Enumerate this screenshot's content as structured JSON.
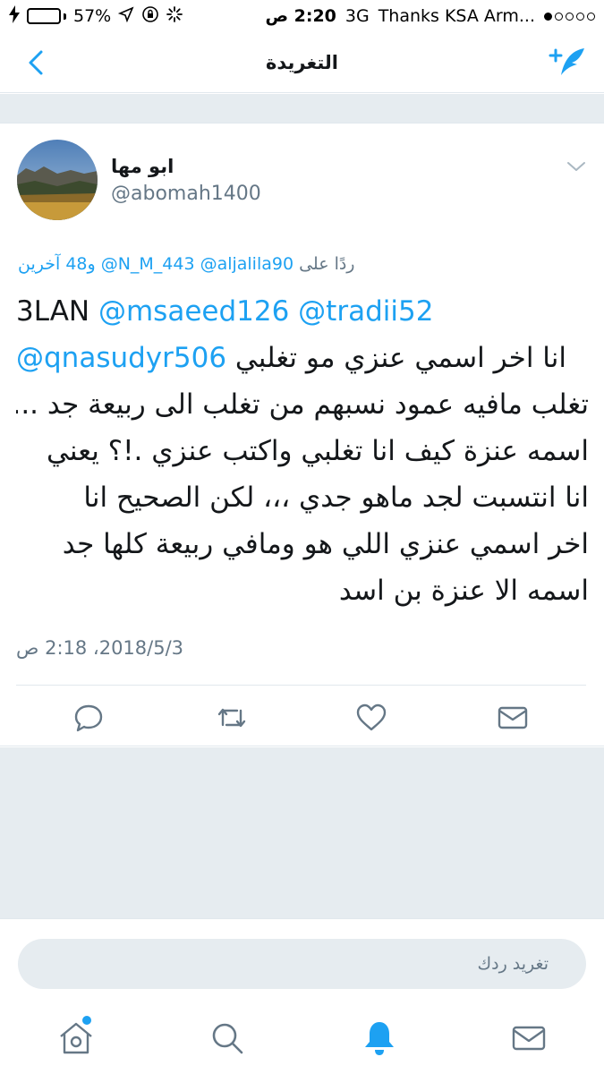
{
  "status_bar": {
    "battery_percent": "57%",
    "battery_level": 0.57,
    "time": "2:20 ص",
    "network": "3G",
    "carrier": "Thanks KSA Arm..."
  },
  "nav": {
    "title": "التغريدة",
    "back_icon": "chevron-left-icon",
    "compose_icon": "compose-quill-icon"
  },
  "tweet": {
    "display_name": "ابو مها",
    "username": "@abomah1400",
    "reply_prefix": "ردًا على",
    "reply_mentions": [
      "@aljalila90",
      "@N_M_443"
    ],
    "reply_others": "و48 آخرين",
    "lines": [
      {
        "dir": "ltr",
        "parts": [
          {
            "t": "3LAN ",
            "m": false
          },
          {
            "t": "@msaeed126",
            "m": true
          },
          {
            "t": " ",
            "m": false
          },
          {
            "t": "@tradii52",
            "m": true
          }
        ]
      },
      {
        "dir": "ltr",
        "parts": [
          {
            "t": "@qnasudyr506",
            "m": true
          },
          {
            "t": " انا اخر اسمي عنزي مو تغلبي",
            "m": false
          }
        ]
      },
      {
        "dir": "rtl",
        "parts": [
          {
            "t": "تغلب مافيه عمود نسبهم من تغلب الى ربيعة جد ...",
            "m": false
          }
        ]
      },
      {
        "dir": "rtl",
        "parts": [
          {
            "t": "اسمه عنزة كيف انا تغلبي واكتب عنزي .!؟ يعني",
            "m": false
          }
        ]
      },
      {
        "dir": "rtl",
        "parts": [
          {
            "t": "انا انتسبت لجد ماهو جدي ،،، لكن الصحيح انا",
            "m": false
          }
        ]
      },
      {
        "dir": "rtl",
        "parts": [
          {
            "t": "اخر اسمي عنزي اللي هو ومافي ربيعة كلها جد",
            "m": false
          }
        ]
      },
      {
        "dir": "rtl",
        "parts": [
          {
            "t": "اسمه الا عنزة بن اسد",
            "m": false
          }
        ]
      }
    ],
    "timestamp": "2018/5/3، 2:18 ص",
    "actions": [
      "reply-icon",
      "retweet-icon",
      "like-icon",
      "direct-message-icon"
    ]
  },
  "composer": {
    "placeholder": "تغريد ردك"
  },
  "tab_bar": {
    "tabs": [
      "home-icon",
      "search-icon",
      "notifications-icon",
      "messages-icon"
    ],
    "active": "notifications-icon"
  },
  "colors": {
    "accent": "#1da1f2",
    "text": "#14171a",
    "secondary": "#657786",
    "background_gray": "#e6ecf0",
    "battery": "#4cd964"
  }
}
